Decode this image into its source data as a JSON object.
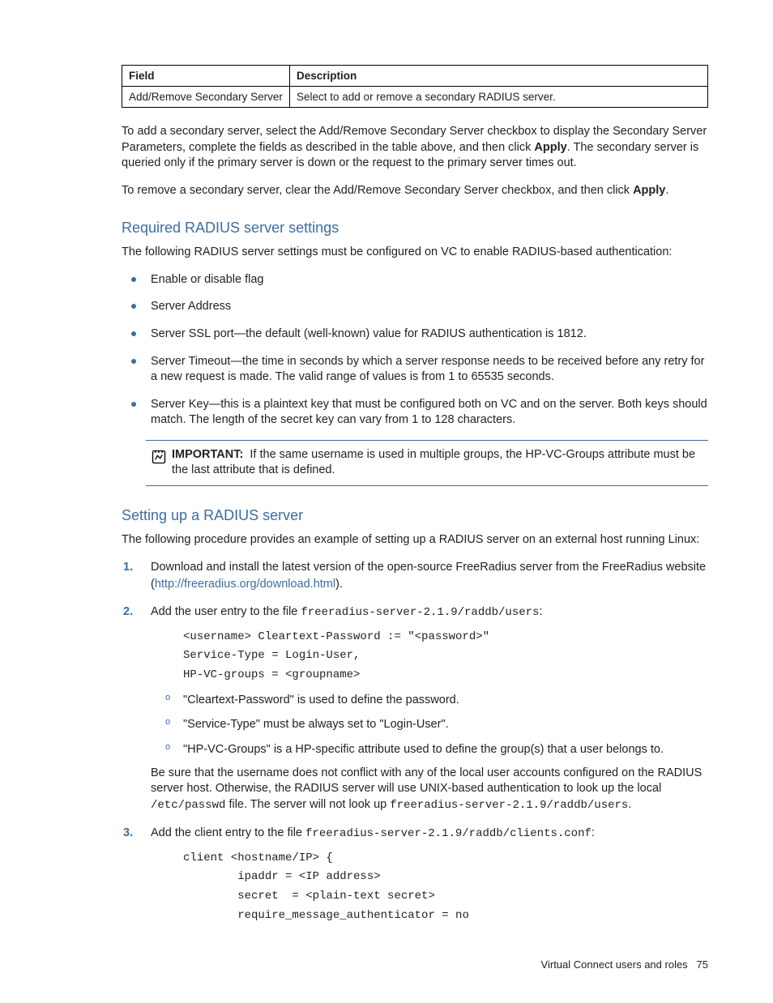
{
  "table": {
    "headers": {
      "field": "Field",
      "desc": "Description"
    },
    "row": {
      "field": "Add/Remove Secondary Server",
      "desc": "Select to add or remove a secondary RADIUS server."
    }
  },
  "para1_pre": "To add a secondary server, select the Add/Remove Secondary Server checkbox to display the Secondary Server Parameters, complete the fields as described in the table above, and then click ",
  "para1_bold": "Apply",
  "para1_post": ". The secondary server is queried only if the primary server is down or the request to the primary server times out.",
  "para2_pre": "To remove a secondary server, clear the Add/Remove Secondary Server checkbox, and then click ",
  "para2_bold": "Apply",
  "para2_post": ".",
  "sec1_title": "Required RADIUS server settings",
  "sec1_intro": "The following RADIUS server settings must be configured on VC to enable RADIUS-based authentication:",
  "sec1_items": {
    "i0": "Enable or disable flag",
    "i1": "Server Address",
    "i2": "Server SSL port—the default (well-known) value for RADIUS authentication is 1812.",
    "i3": "Server Timeout—the time in seconds by which a server response needs to be received before any retry for a new request is made. The valid range of values is from 1 to 65535 seconds.",
    "i4": "Server Key—this is a plaintext key that must be configured both on VC and on the server. Both keys should match. The length of the secret key can vary from 1 to 128 characters."
  },
  "callout": {
    "label": "IMPORTANT:",
    "text": "If the same username is used in multiple groups, the HP-VC-Groups attribute must be the last attribute that is defined."
  },
  "sec2_title": "Setting up a RADIUS server",
  "sec2_intro": "The following procedure provides an example of setting up a RADIUS server on an external host running Linux:",
  "step1_pre": "Download and install the latest version of the open-source FreeRadius server from the FreeRadius website (",
  "step1_link": "http://freeradius.org/download.html",
  "step1_post": ").",
  "step2_pre": "Add the user entry to the file ",
  "step2_file": "freeradius-server-2.1.9/raddb/users",
  "step2_post": ":",
  "step2_code": "<username> Cleartext-Password := \"<password>\"\nService-Type = Login-User,\nHP-VC-groups = <groupname>",
  "step2_sub": {
    "s0": "\"Cleartext-Password\" is used to define the password.",
    "s1": "\"Service-Type\" must be always set to \"Login-User\".",
    "s2": "\"HP-VC-Groups\" is a HP-specific attribute used to define the group(s) that a user belongs to."
  },
  "step2_note_a": "Be sure that the username does not conflict with any of the local user accounts configured on the RADIUS server host. Otherwise, the RADIUS server will use UNIX-based authentication to look up the local ",
  "step2_note_b": "/etc/passwd",
  "step2_note_c": " file. The server will not look up ",
  "step2_note_d": "freeradius-server-2.1.9/raddb/users",
  "step2_note_e": ".",
  "step3_pre": "Add the client entry to the file ",
  "step3_file": "freeradius-server-2.1.9/raddb/clients.conf",
  "step3_post": ":",
  "step3_code": "client <hostname/IP> {\n        ipaddr = <IP address>\n        secret  = <plain-text secret>\n        require_message_authenticator = no",
  "footer": {
    "text": "Virtual Connect users and roles",
    "page": "75"
  }
}
